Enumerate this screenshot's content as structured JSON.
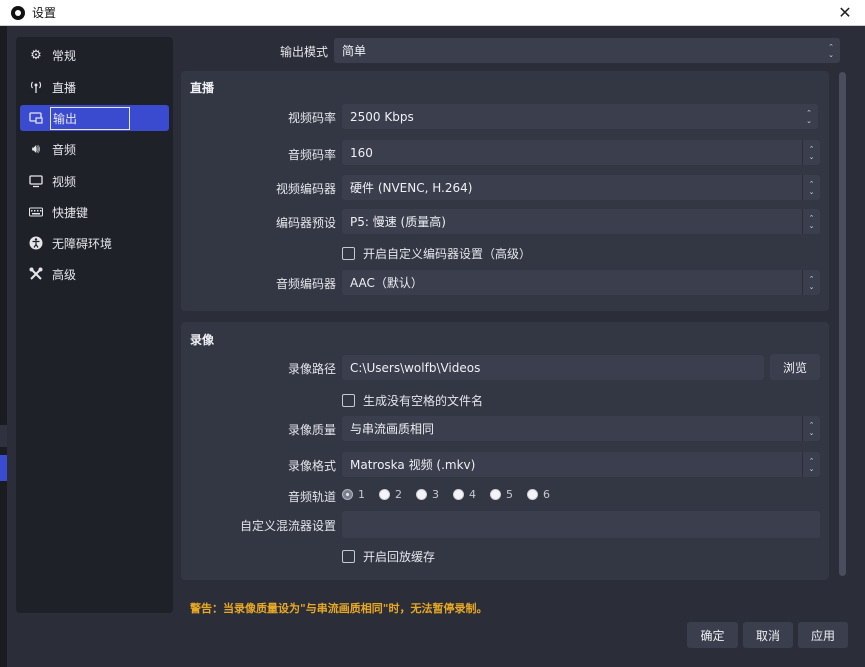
{
  "window": {
    "title": "设置"
  },
  "sidebar": {
    "items": [
      {
        "label": "常规",
        "icon": "gear-icon"
      },
      {
        "label": "直播",
        "icon": "broadcast-icon"
      },
      {
        "label": "输出",
        "icon": "output-icon"
      },
      {
        "label": "音频",
        "icon": "speaker-icon"
      },
      {
        "label": "视频",
        "icon": "monitor-icon"
      },
      {
        "label": "快捷键",
        "icon": "keyboard-icon"
      },
      {
        "label": "无障碍环境",
        "icon": "accessibility-icon"
      },
      {
        "label": "高级",
        "icon": "tools-icon"
      }
    ],
    "active_index": 2
  },
  "output_mode": {
    "label": "输出模式",
    "value": "简单"
  },
  "streaming": {
    "title": "直播",
    "video_bitrate": {
      "label": "视频码率",
      "value": "2500 Kbps"
    },
    "audio_bitrate": {
      "label": "音频码率",
      "value": "160"
    },
    "video_encoder": {
      "label": "视频编码器",
      "value": "硬件 (NVENC, H.264)"
    },
    "encoder_preset": {
      "label": "编码器预设",
      "value": "P5: 慢速 (质量高)"
    },
    "custom_encoder_checkbox": {
      "label": "开启自定义编码器设置（高级）",
      "checked": false
    },
    "audio_encoder": {
      "label": "音频编码器",
      "value": "AAC（默认）"
    }
  },
  "recording": {
    "title": "录像",
    "path": {
      "label": "录像路径",
      "value": "C:\\Users\\wolfb\\Videos",
      "browse_label": "浏览"
    },
    "no_space_checkbox": {
      "label": "生成没有空格的文件名",
      "checked": false
    },
    "quality": {
      "label": "录像质量",
      "value": "与串流画质相同"
    },
    "format": {
      "label": "录像格式",
      "value": "Matroska 视频 (.mkv)"
    },
    "audio_track": {
      "label": "音频轨道",
      "tracks": [
        "1",
        "2",
        "3",
        "4",
        "5",
        "6"
      ],
      "selected": "1"
    },
    "custom_muxer": {
      "label": "自定义混流器设置",
      "value": ""
    },
    "replay_buffer_checkbox": {
      "label": "开启回放缓存",
      "checked": false
    }
  },
  "warning": "警告：当录像质量设为\"与串流画质相同\"时，无法暂停录制。",
  "buttons": {
    "ok": "确定",
    "cancel": "取消",
    "apply": "应用"
  },
  "colors": {
    "accent": "#3b4bd0",
    "warning": "#e8a825",
    "panel": "#333744",
    "field": "#3a3e4d"
  }
}
